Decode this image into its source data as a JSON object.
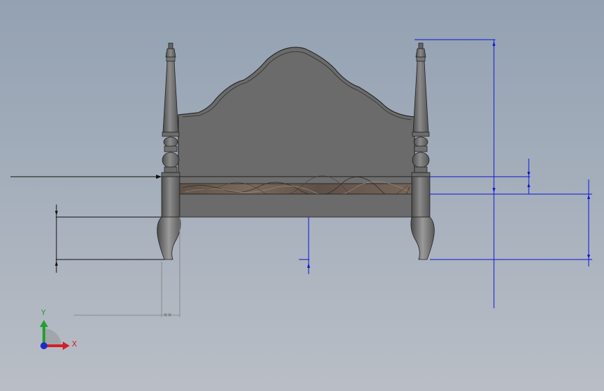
{
  "viewport": {
    "title": "",
    "background_top": "#93a1b2",
    "background_bottom": "#b9bec6"
  },
  "model": {
    "name": "",
    "body_color": "#6d6d6d",
    "outline_color": "#2a2a2a",
    "marble_color": "#6b5c50"
  },
  "dimensions": {
    "color": "#0a14d8",
    "black_color": "#111111",
    "values": []
  },
  "triad": {
    "x_label": "X",
    "y_label": "Y",
    "x_color": "#d0202a",
    "y_color": "#22a030",
    "z_color": "#1a2cc8",
    "icon": "coordinate-triad-icon"
  }
}
